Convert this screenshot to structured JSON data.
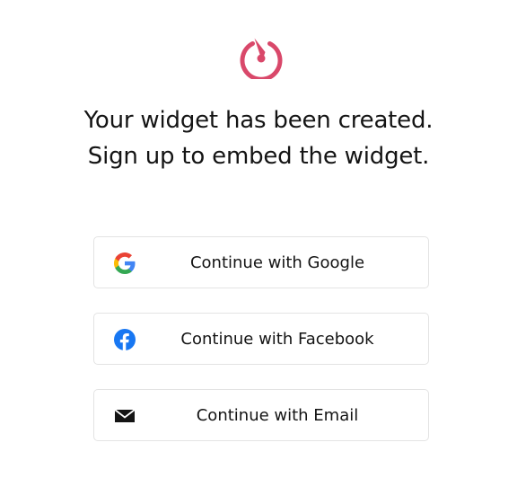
{
  "brand": {
    "logo_icon": "gauge-logo-icon",
    "accent_color": "#d9486a"
  },
  "message": {
    "line1": "Your widget has been created.",
    "line2": "Sign up to embed the widget."
  },
  "auth_buttons": [
    {
      "label": "Continue with Google",
      "icon": "google-icon"
    },
    {
      "label": "Continue with Facebook",
      "icon": "facebook-icon",
      "color": "#1877f2"
    },
    {
      "label": "Continue with Email",
      "icon": "envelope-icon"
    }
  ]
}
